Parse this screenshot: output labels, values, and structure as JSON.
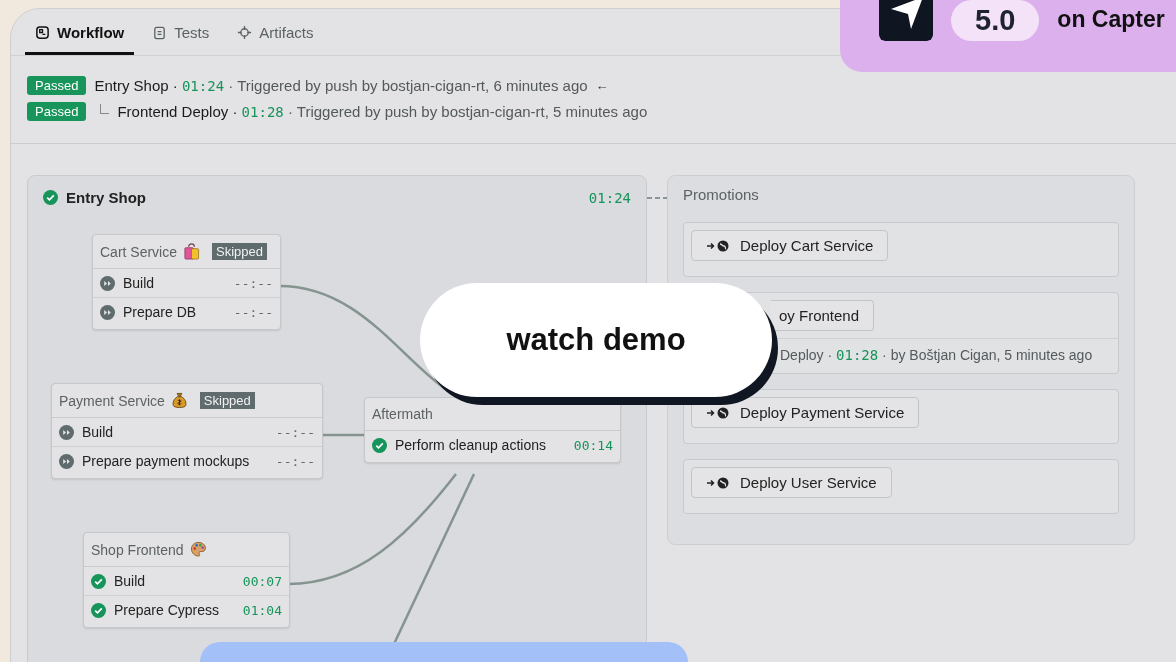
{
  "tabs": [
    {
      "label": "Workflow",
      "selected": true
    },
    {
      "label": "Tests",
      "selected": false
    },
    {
      "label": "Artifacts",
      "selected": false
    }
  ],
  "runs": [
    {
      "status": "Passed",
      "name": "Entry Shop ·",
      "duration": "01:24",
      "trigger": "· Triggered by push by bostjan-cigan-rt, 6 minutes ago",
      "marker": "←",
      "children": [
        {
          "status": "Passed",
          "name": "Frontend Deploy ·",
          "duration": "01:28",
          "trigger": "· Triggered by push by bostjan-cigan-rt, 5 minutes ago"
        }
      ]
    }
  ],
  "pipeline": {
    "title": "Entry Shop",
    "passed": true,
    "duration": "01:24",
    "blocks": [
      {
        "name": "Cart Service",
        "badge": "Skipped",
        "steps": [
          {
            "name": "Build",
            "kind": "skipped",
            "duration": "--:--"
          },
          {
            "name": "Prepare DB",
            "kind": "skipped",
            "duration": "--:--"
          }
        ]
      },
      {
        "name": "Payment Service",
        "badge": "Skipped",
        "steps": [
          {
            "name": "Build",
            "kind": "skipped",
            "duration": "--:--"
          },
          {
            "name": "Prepare payment mockups",
            "kind": "skipped",
            "duration": "--:--"
          }
        ]
      },
      {
        "name": "Shop Frontend",
        "steps": [
          {
            "name": "Build",
            "kind": "passed",
            "duration": "00:07"
          },
          {
            "name": "Prepare Cypress",
            "kind": "passed",
            "duration": "01:04"
          }
        ]
      },
      {
        "name": "Aftermath",
        "steps": [
          {
            "name": "Perform cleanup actions",
            "kind": "passed",
            "duration": "00:14"
          }
        ]
      }
    ]
  },
  "promotions": {
    "title": "Promotions",
    "items": [
      {
        "label": "Deploy Cart Service"
      },
      {
        "label": "oy Frontend",
        "run": {
          "name": "Deploy ·",
          "duration": "01:28",
          "by": "· by Boštjan Cigan, 5 minutes ago"
        }
      },
      {
        "label": "Deploy Payment Service"
      },
      {
        "label": "Deploy User Service"
      }
    ]
  },
  "rating": {
    "score": "5.0",
    "text": "on Capter"
  },
  "demo_button": "watch demo"
}
